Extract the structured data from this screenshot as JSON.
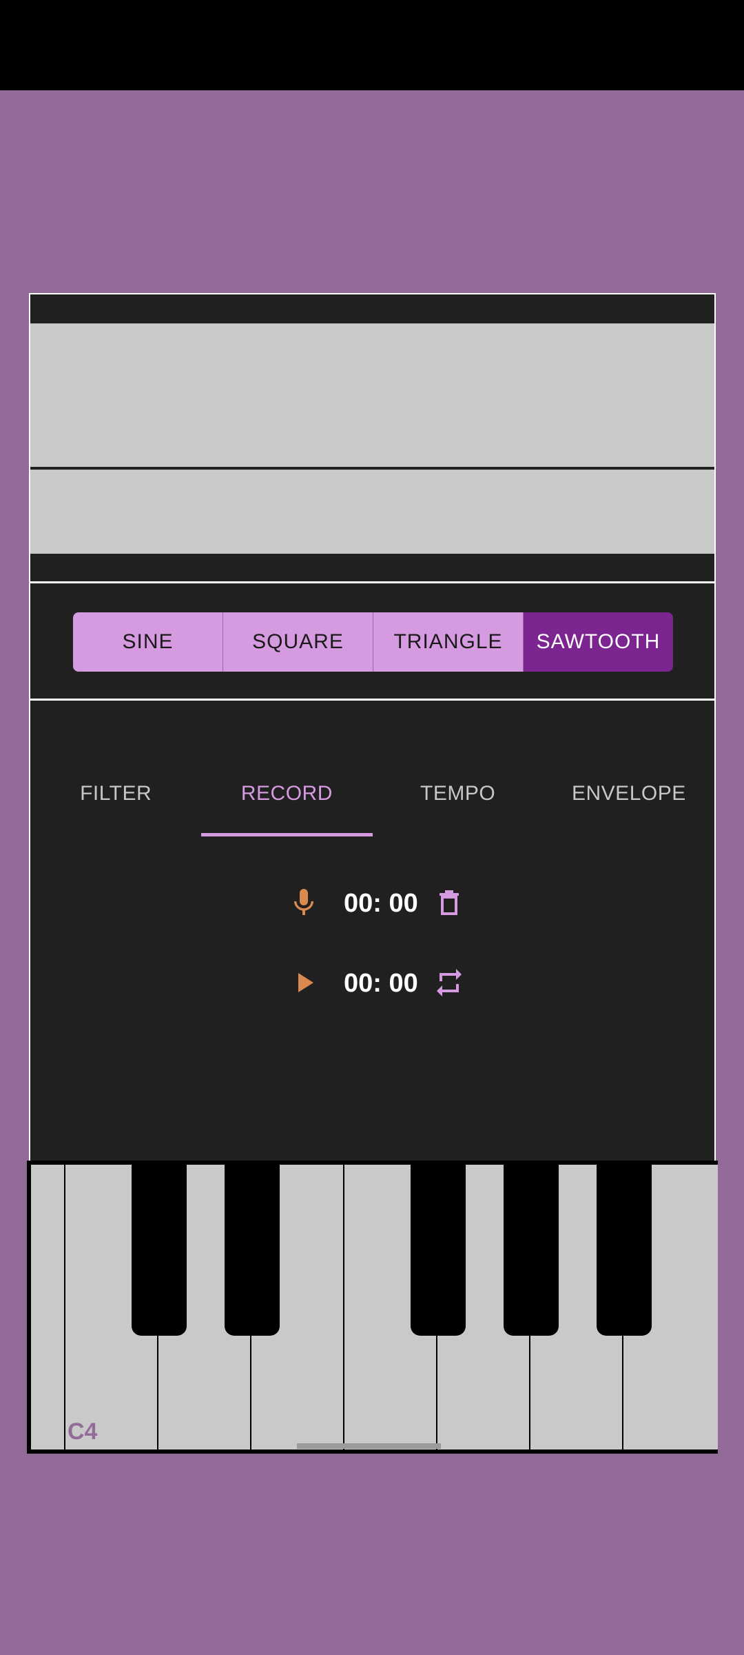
{
  "waveform": {
    "options": [
      "SINE",
      "SQUARE",
      "TRIANGLE",
      "SAWTOOTH"
    ],
    "selected": "SAWTOOTH"
  },
  "tabs": {
    "items": [
      "FILTER",
      "RECORD",
      "TEMPO",
      "ENVELOPE"
    ],
    "active": "RECORD"
  },
  "record": {
    "record_time": "00: 00",
    "play_time": "00: 00"
  },
  "keyboard": {
    "start_note_label": "C4"
  },
  "colors": {
    "background": "#926b99",
    "panel": "#202020",
    "accent": "#d69ae0",
    "accent_selected": "#7c2590",
    "record_icon": "#d98a4e"
  },
  "icons": {
    "record": "microphone-icon",
    "delete": "trash-icon",
    "play": "play-icon",
    "loop": "repeat-icon"
  }
}
